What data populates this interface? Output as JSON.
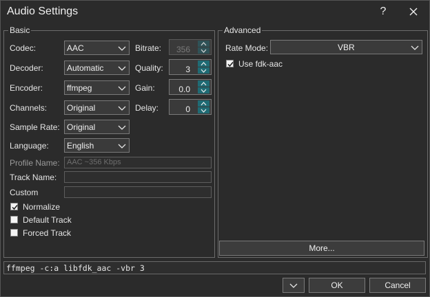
{
  "window": {
    "title": "Audio Settings",
    "help_label": "?",
    "close_label": "✕"
  },
  "basic": {
    "legend": "Basic",
    "codec": {
      "label": "Codec:",
      "value": "AAC"
    },
    "decoder": {
      "label": "Decoder:",
      "value": "Automatic"
    },
    "encoder": {
      "label": "Encoder:",
      "value": "ffmpeg"
    },
    "channels": {
      "label": "Channels:",
      "value": "Original"
    },
    "sample_rate": {
      "label": "Sample Rate:",
      "value": "Original"
    },
    "language": {
      "label": "Language:",
      "value": "English"
    },
    "bitrate": {
      "label": "Bitrate:",
      "value": "356"
    },
    "quality": {
      "label": "Quality:",
      "value": "3"
    },
    "gain": {
      "label": "Gain:",
      "value": "0.0"
    },
    "delay": {
      "label": "Delay:",
      "value": "0"
    },
    "profile_name": {
      "label": "Profile Name:",
      "value": "AAC ~356 Kbps"
    },
    "track_name": {
      "label": "Track Name:",
      "value": ""
    },
    "custom": {
      "label": "Custom",
      "value": ""
    },
    "normalize": {
      "label": "Normalize",
      "checked": true
    },
    "default_track": {
      "label": "Default Track",
      "checked": false
    },
    "forced_track": {
      "label": "Forced Track",
      "checked": false
    }
  },
  "advanced": {
    "legend": "Advanced",
    "rate_mode": {
      "label": "Rate Mode:",
      "value": "VBR"
    },
    "use_fdk": {
      "label": "Use fdk-aac",
      "checked": true
    },
    "more_label": "More..."
  },
  "command_line": "ffmpeg -c:a libfdk_aac -vbr 3",
  "footer": {
    "ok_label": "OK",
    "cancel_label": "Cancel"
  },
  "colors": {
    "background": "#2b2b2b",
    "spin_accent": "#1f6b74",
    "border": "#7a7a7a"
  }
}
